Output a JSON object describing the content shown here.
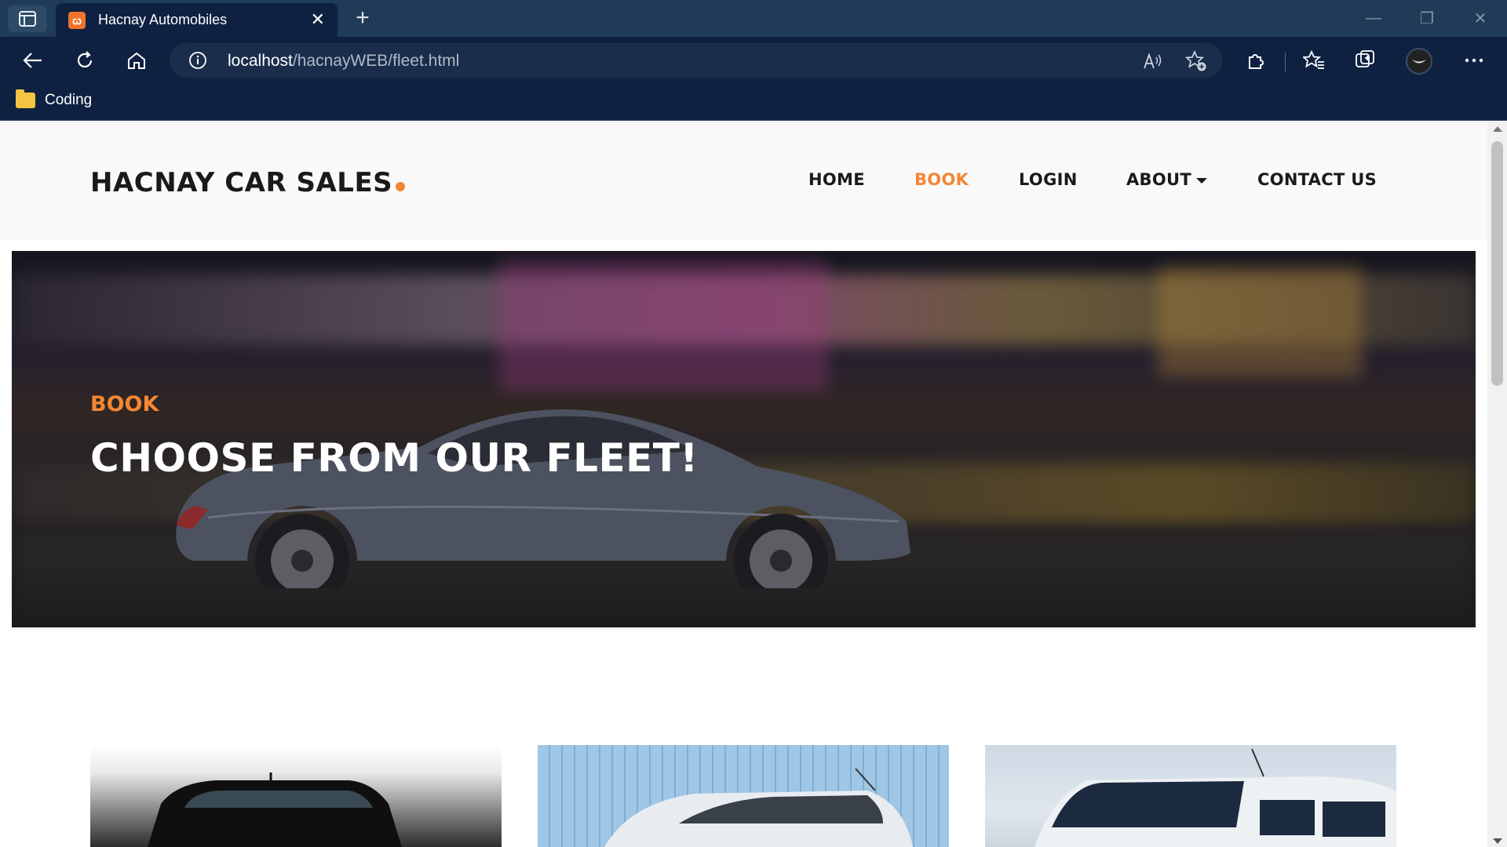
{
  "browser": {
    "tab_title": "Hacnay Automobiles",
    "url_host": "localhost",
    "url_path": "/hacnayWEB/fleet.html",
    "bookmark_folder": "Coding"
  },
  "site": {
    "brand": "HACNAY CAR SALES",
    "accent_color": "#f58634",
    "menu": {
      "home": "HOME",
      "book": "BOOK",
      "login": "LOGIN",
      "about": "ABOUT",
      "contact": "CONTACT US"
    },
    "active_menu": "BOOK",
    "hero": {
      "kicker": "BOOK",
      "title": "CHOOSE FROM OUR FLEET!"
    }
  }
}
